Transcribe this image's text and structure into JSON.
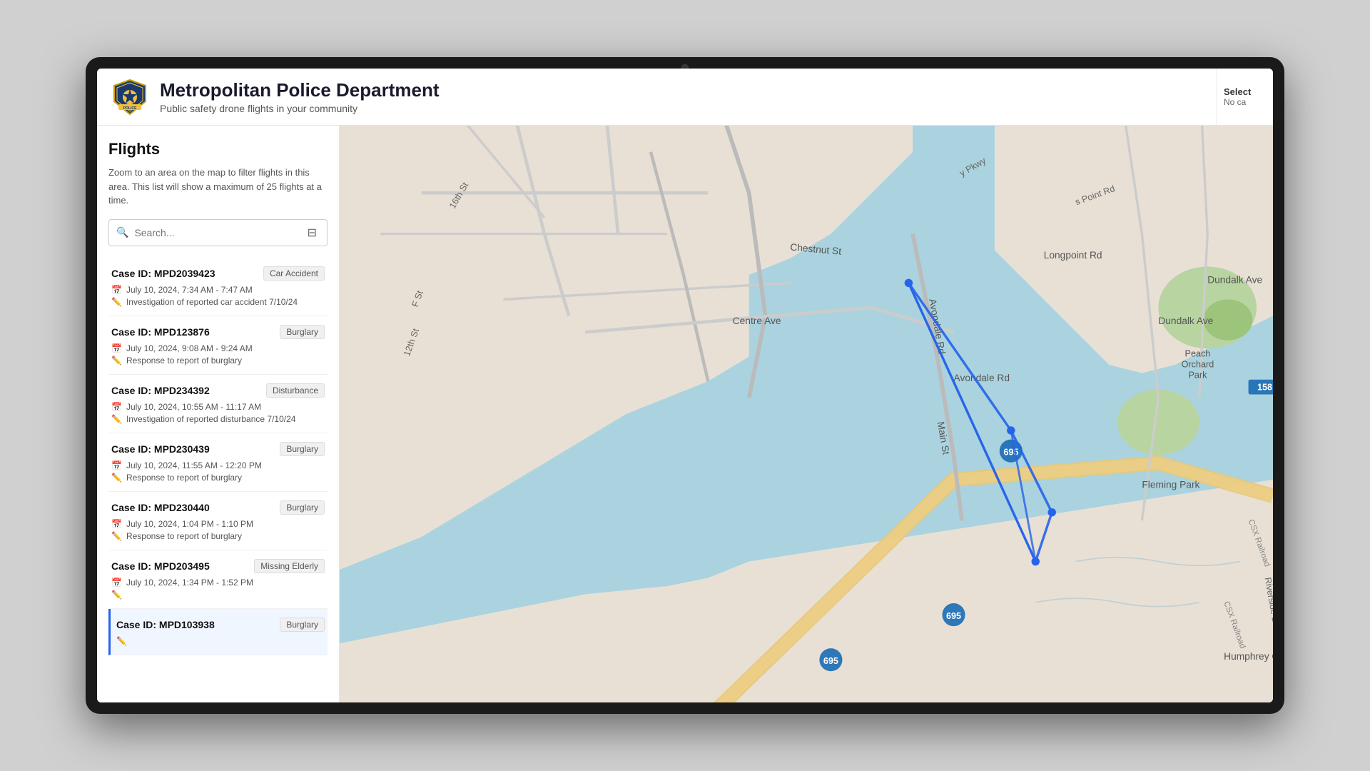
{
  "header": {
    "title": "Metropolitan Police Department",
    "subtitle": "Public safety drone flights in your community",
    "select_label": "Select",
    "select_value": "No ca"
  },
  "sidebar": {
    "title": "Flights",
    "description": "Zoom to an area on the map to filter flights in this area. This list will show a maximum of 25 flights at a time.",
    "search_placeholder": "Search...",
    "filter_icon": "⊟"
  },
  "cases": [
    {
      "id": "Case ID: MPD2039423",
      "tag": "Car Accident",
      "date": "July 10, 2024, 7:34 AM - 7:47 AM",
      "description": "Investigation of reported car accident 7/10/24",
      "active": false
    },
    {
      "id": "Case ID: MPD123876",
      "tag": "Burglary",
      "date": "July 10, 2024, 9:08 AM - 9:24 AM",
      "description": "Response to report of burglary",
      "active": false
    },
    {
      "id": "Case ID: MPD234392",
      "tag": "Disturbance",
      "date": "July 10, 2024, 10:55 AM - 11:17 AM",
      "description": "Investigation of reported disturbance 7/10/24",
      "active": false
    },
    {
      "id": "Case ID: MPD230439",
      "tag": "Burglary",
      "date": "July 10, 2024, 11:55 AM - 12:20 PM",
      "description": "Response to report of burglary",
      "active": false
    },
    {
      "id": "Case ID: MPD230440",
      "tag": "Burglary",
      "date": "July 10, 2024, 1:04 PM - 1:10 PM",
      "description": "Response to report of burglary",
      "active": false
    },
    {
      "id": "Case ID: MPD203495",
      "tag": "Missing Elderly",
      "date": "July 10, 2024, 1:34 PM - 1:52 PM",
      "description": "",
      "active": false
    },
    {
      "id": "Case ID: MPD103938",
      "tag": "Burglary",
      "date": "",
      "description": "",
      "active": true
    }
  ]
}
